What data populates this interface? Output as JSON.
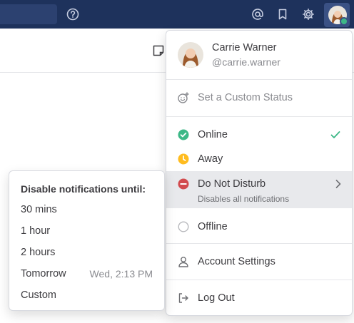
{
  "topbar": {
    "icons": [
      "help-icon",
      "mention-icon",
      "bookmark-icon",
      "gear-icon"
    ],
    "avatar_status_color": "#3db887",
    "background_color": "#1e325c"
  },
  "profile": {
    "name": "Carrie Warner",
    "handle": "@carrie.warner"
  },
  "status_menu": {
    "custom_status_label": "Set a Custom Status",
    "items": [
      {
        "label": "Online",
        "color": "#3db887",
        "selected": true
      },
      {
        "label": "Away",
        "color": "#ffbc1f"
      },
      {
        "label": "Do Not Disturb",
        "sublabel": "Disables all notifications",
        "color": "#d24b4e"
      },
      {
        "label": "Offline",
        "color": "#b8b9bd"
      }
    ],
    "account_settings_label": "Account Settings",
    "logout_label": "Log Out"
  },
  "dnd_submenu": {
    "title": "Disable notifications until:",
    "options": [
      {
        "label": "30 mins"
      },
      {
        "label": "1 hour"
      },
      {
        "label": "2 hours"
      },
      {
        "label": "Tomorrow",
        "hint": "Wed, 2:13 PM"
      },
      {
        "label": "Custom"
      }
    ]
  }
}
